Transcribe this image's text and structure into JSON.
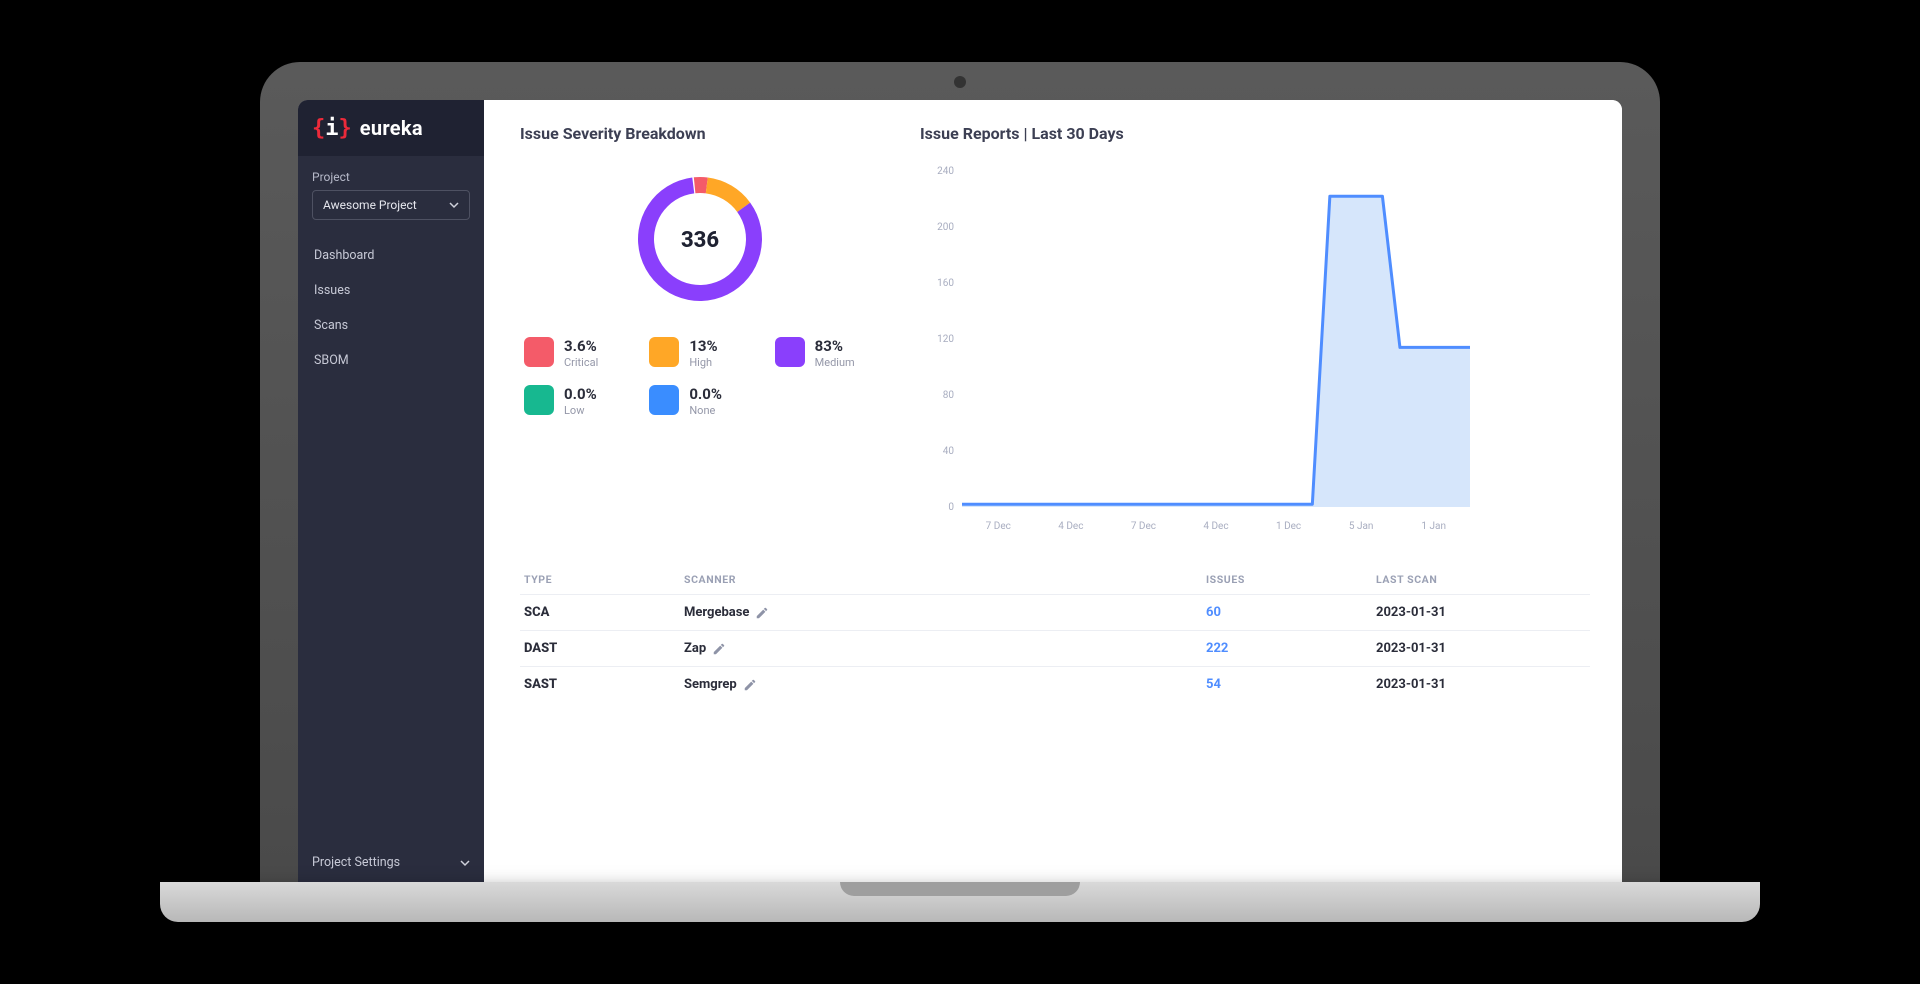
{
  "brand": {
    "name": "eureka"
  },
  "sidebar": {
    "project_label": "Project",
    "project_selected": "Awesome Project",
    "nav": [
      {
        "label": "Dashboard"
      },
      {
        "label": "Issues"
      },
      {
        "label": "Scans"
      },
      {
        "label": "SBOM"
      }
    ],
    "settings_label": "Project Settings"
  },
  "severity": {
    "title": "Issue Severity Breakdown",
    "total": "336",
    "items": [
      {
        "pct": "3.6%",
        "name": "Critical",
        "color": "#f45b69"
      },
      {
        "pct": "13%",
        "name": "High",
        "color": "#ffa726"
      },
      {
        "pct": "83%",
        "name": "Medium",
        "color": "#8a3ffc"
      },
      {
        "pct": "0.0%",
        "name": "Low",
        "color": "#17b890"
      },
      {
        "pct": "0.0%",
        "name": "None",
        "color": "#3a8dff"
      }
    ]
  },
  "reports": {
    "title": "Issue Reports | Last 30 Days"
  },
  "table": {
    "headers": {
      "type": "TYPE",
      "scanner": "SCANNER",
      "issues": "ISSUES",
      "last_scan": "LAST SCAN"
    },
    "rows": [
      {
        "type": "SCA",
        "scanner": "Mergebase",
        "issues": "60",
        "last_scan": "2023-01-31"
      },
      {
        "type": "DAST",
        "scanner": "Zap",
        "issues": "222",
        "last_scan": "2023-01-31"
      },
      {
        "type": "SAST",
        "scanner": "Semgrep",
        "issues": "54",
        "last_scan": "2023-01-31"
      }
    ]
  },
  "chart_data": {
    "type": "area",
    "title": "Issue Reports | Last 30 Days",
    "xlabel": "",
    "ylabel": "",
    "ylim": [
      0,
      240
    ],
    "y_ticks": [
      0,
      40,
      80,
      120,
      160,
      200,
      240
    ],
    "x_tick_labels": [
      "7 Dec",
      "4 Dec",
      "7 Dec",
      "4 Dec",
      "1 Dec",
      "5 Jan",
      "1 Jan"
    ],
    "series": [
      {
        "name": "Issues",
        "color": "#4f8dff",
        "values": [
          2,
          2,
          2,
          2,
          2,
          2,
          2,
          2,
          2,
          2,
          2,
          2,
          2,
          2,
          2,
          2,
          2,
          2,
          2,
          2,
          2,
          222,
          222,
          222,
          222,
          114,
          114,
          114,
          114,
          114
        ]
      }
    ]
  }
}
